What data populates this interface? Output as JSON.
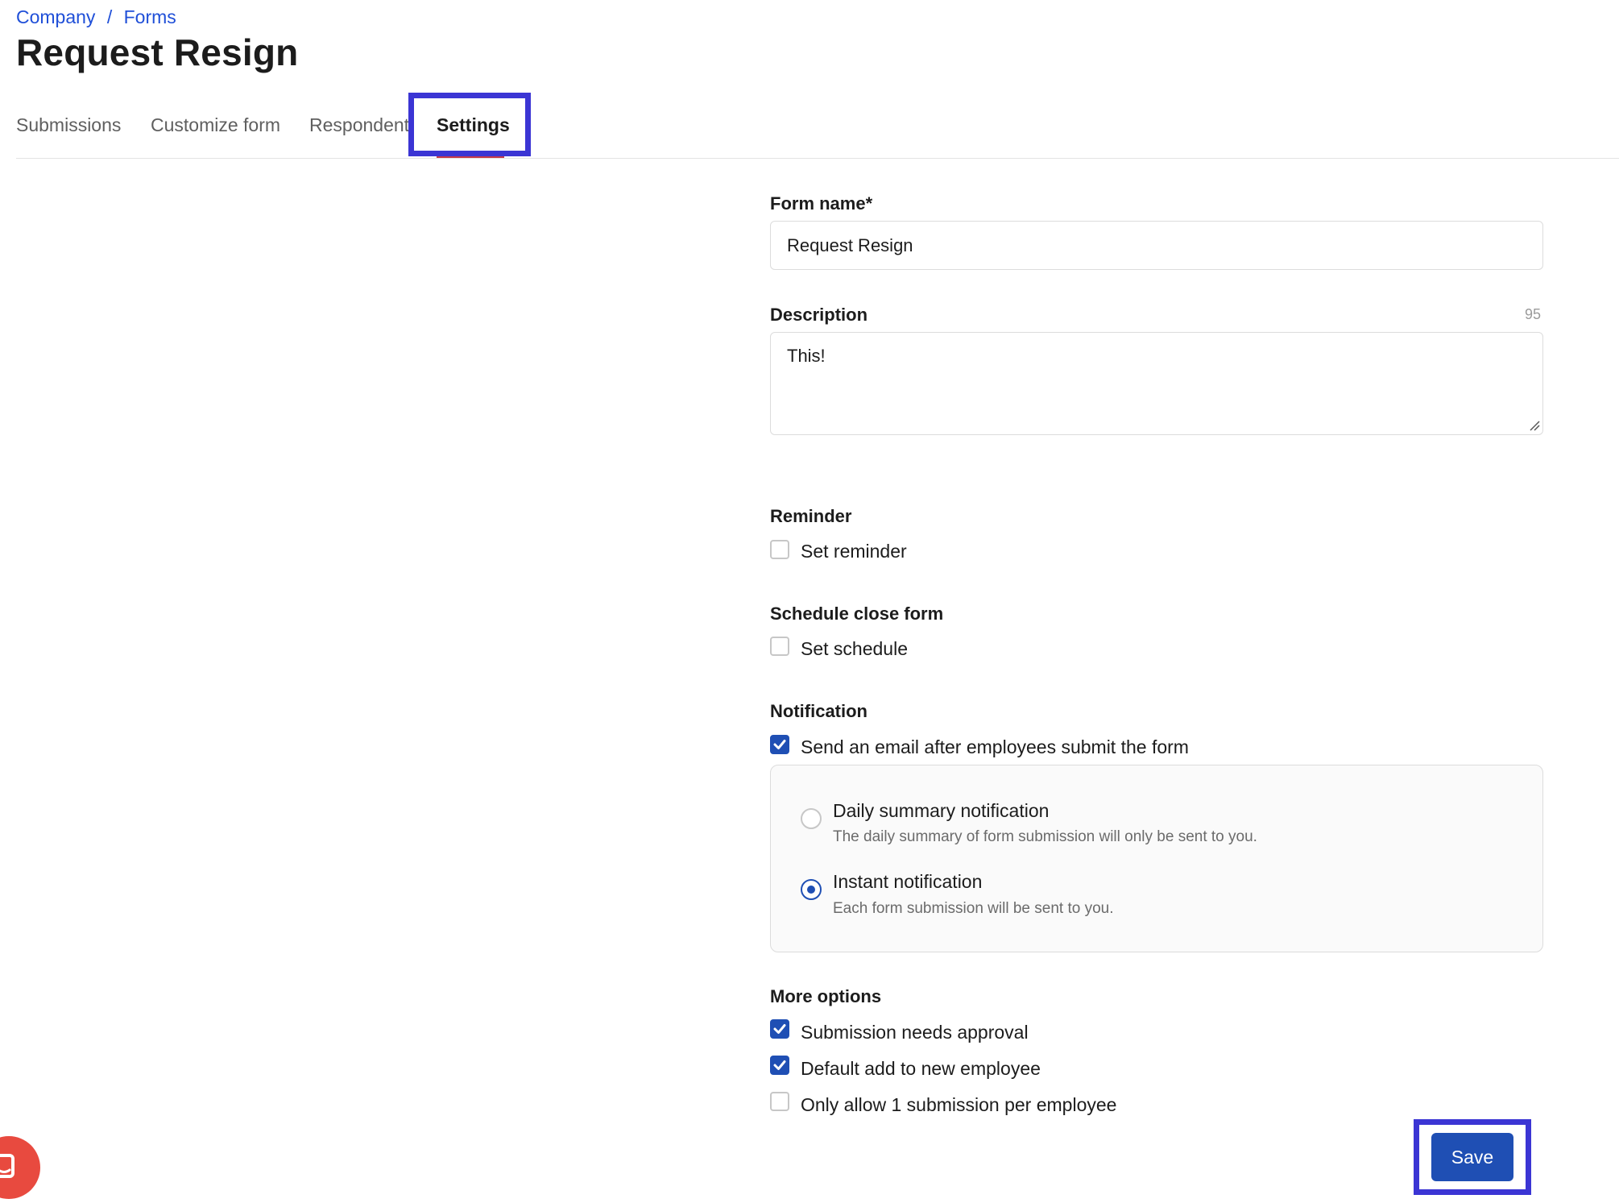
{
  "breadcrumb": {
    "parent": "Company",
    "separator": "/",
    "current": "Forms"
  },
  "page": {
    "title": "Request Resign"
  },
  "tabs": [
    {
      "label": "Submissions",
      "active": false
    },
    {
      "label": "Customize form",
      "active": false
    },
    {
      "label": "Respondent",
      "active": false
    },
    {
      "label": "Settings",
      "active": true
    }
  ],
  "form": {
    "name_label": "Form name*",
    "name_value": "Request Resign",
    "description_label": "Description",
    "description_counter": "95",
    "description_value": "This!"
  },
  "reminder": {
    "heading": "Reminder",
    "option": "Set reminder",
    "checked": false
  },
  "schedule": {
    "heading": "Schedule close form",
    "option": "Set schedule",
    "checked": false
  },
  "notification": {
    "heading": "Notification",
    "option": "Send an email after employees submit the form",
    "checked": true,
    "choices": [
      {
        "title": "Daily summary notification",
        "description": "The daily summary of form submission will only be sent to you.",
        "selected": false
      },
      {
        "title": "Instant notification",
        "description": "Each form submission will be sent to you.",
        "selected": true
      }
    ]
  },
  "more_options": {
    "heading": "More options",
    "items": [
      {
        "label": "Submission needs approval",
        "checked": true
      },
      {
        "label": "Default add to new employee",
        "checked": true
      },
      {
        "label": "Only allow 1 submission per employee",
        "checked": false
      }
    ]
  },
  "actions": {
    "save_label": "Save"
  },
  "colors": {
    "accent": "#1f4fb4",
    "link": "#1f4fd8",
    "highlight": "#3b35d4",
    "tab_underline": "#c43a4a",
    "chat": "#e84a3f"
  },
  "icons": {
    "checkbox_check": "check-icon",
    "chat": "chat-icon",
    "resize": "resize-handle-icon"
  }
}
